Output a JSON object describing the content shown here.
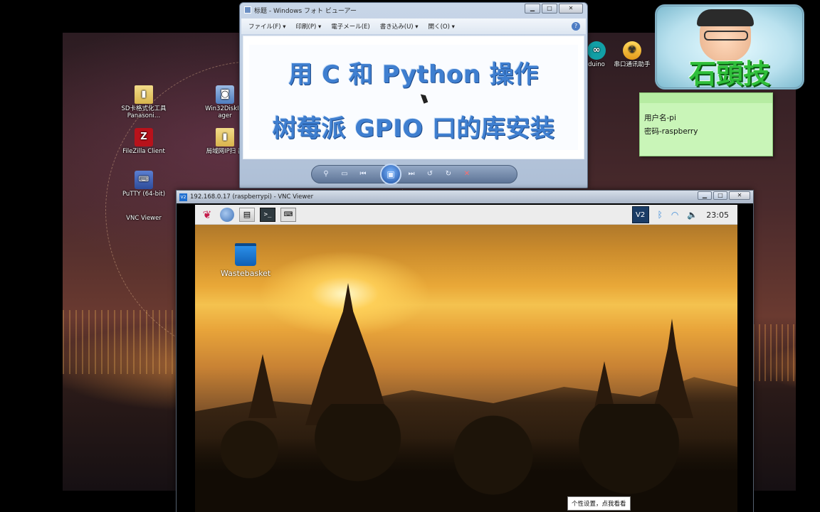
{
  "host_desktop": {
    "icons": [
      {
        "name": "sd-formatter",
        "label": "SD卡格式化工具Panasoni…",
        "glyph": "▮",
        "kind": "folder"
      },
      {
        "name": "win32diskimager",
        "label": "Win32DiskIm ager",
        "glyph": "◙",
        "kind": "disk"
      },
      {
        "name": "filezilla",
        "label": "FileZilla Client",
        "glyph": "Z",
        "kind": "fz"
      },
      {
        "name": "lan-ip-scanner",
        "label": "局域网IP扫 器",
        "glyph": "▮",
        "kind": "folder"
      },
      {
        "name": "putty",
        "label": "PuTTY (64-bit)",
        "glyph": "⌨",
        "kind": "putty"
      },
      {
        "name": "vnc-viewer",
        "label": "VNC Viewer",
        "glyph": "V2",
        "kind": "vnc"
      },
      {
        "name": "arduino",
        "label": "duino",
        "glyph": "∞",
        "kind": "arduino"
      },
      {
        "name": "serial-assistant",
        "label": "串口通讯助手",
        "glyph": "☢",
        "kind": "serial"
      }
    ]
  },
  "photo_viewer": {
    "title": "标题 - Windows フォト ビューアー",
    "menu": [
      "ファイル(F) ▾",
      "印刷(P) ▾",
      "電子メール(E)",
      "書き込み(U) ▾",
      "開く(O) ▾"
    ],
    "help_glyph": "?",
    "headline_line1": "用 C 和 Python 操作",
    "headline_line2": "树莓派 GPIO 口的库安装",
    "toolbar": {
      "zoom": "⚲",
      "fit": "▭",
      "prev": "⏮",
      "slideshow": "▣",
      "next": "⏭",
      "rotate_ccw": "↺",
      "rotate_cw": "↻",
      "delete": "✕"
    }
  },
  "window_controls": {
    "minimize": "▁",
    "maximize": "□",
    "close": "✕"
  },
  "sticky_note": {
    "line1": "用户名-pi",
    "line2": "密码-raspberry"
  },
  "logo": {
    "text": "石頭技"
  },
  "vnc_window": {
    "title": "192.168.0.17 (raspberrypi) - VNC Viewer",
    "title_icon": "V2",
    "pi_desktop": {
      "panel": {
        "menu_glyph": "❦",
        "browser_glyph": "",
        "files_glyph": "▤",
        "terminal_glyph": ">_",
        "keyboard_glyph": "⌨",
        "vnc_tray": "V2",
        "bluetooth": "ᛒ",
        "wifi": "◠",
        "volume": "🔈",
        "clock": "23:05"
      },
      "trash_label": "Wastebasket"
    }
  },
  "tooltip": {
    "text": "个性设置，点我看看"
  }
}
